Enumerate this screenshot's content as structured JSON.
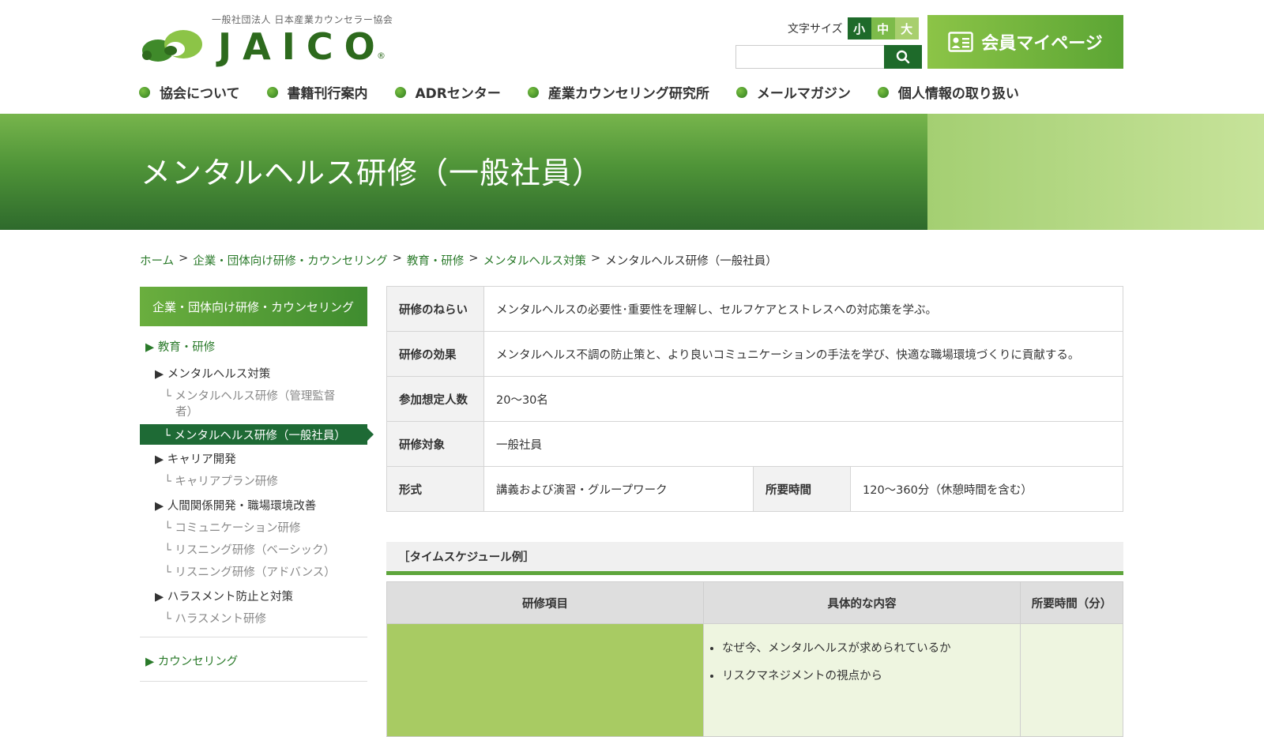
{
  "header": {
    "org_sub": "一般社団法人 日本産業カウンセラー協会",
    "logo_text": "JAICO",
    "logo_reg": "®",
    "fontsize_label": "文字サイズ",
    "fontsize_options": [
      "小",
      "中",
      "大"
    ],
    "search_placeholder": "",
    "mypage_label": "会員マイページ"
  },
  "gnav": [
    "協会について",
    "書籍刊行案内",
    "ADRセンター",
    "産業カウンセリング研究所",
    "メールマガジン",
    "個人情報の取り扱い"
  ],
  "hero": {
    "title": "メンタルヘルス研修（一般社員）"
  },
  "breadcrumb": {
    "items": [
      "ホーム",
      "企業・団体向け研修・カウンセリング",
      "教育・研修",
      "メンタルヘルス対策"
    ],
    "separator": ">",
    "current": "メンタルヘルス研修（一般社員）"
  },
  "sidebar": {
    "heading": "企業・団体向け研修・カウンセリング",
    "education": "▶ 教育・研修",
    "mental": "▶ メンタルヘルス対策",
    "mental_mgmt": "└ メンタルヘルス研修（管理監督",
    "mental_mgmt2": "者）",
    "mental_general": "└ メンタルヘルス研修（一般社員）",
    "career": "▶ キャリア開発",
    "career_plan": "└ キャリアプラン研修",
    "relations": "▶ 人間関係開発・職場環境改善",
    "communication": "└ コミュニケーション研修",
    "listening_basic": "└ リスニング研修（ベーシック）",
    "listening_adv": "└ リスニング研修（アドバンス）",
    "harassment": "▶ ハラスメント防止と対策",
    "harassment_train": "└ ハラスメント研修",
    "counseling": "▶ カウンセリング"
  },
  "info": {
    "aim_label": "研修のねらい",
    "aim": "メンタルヘルスの必要性･重要性を理解し、セルフケアとストレスへの対応策を学ぶ。",
    "effect_label": "研修の効果",
    "effect": "メンタルヘルス不調の防止策と、より良いコミュニケーションの手法を学び、快適な職場環境づくりに貢献する。",
    "people_label": "参加想定人数",
    "people": "20～30名",
    "target_label": "研修対象",
    "target": "一般社員",
    "format_label": "形式",
    "format": "講義および演習・グループワーク",
    "time_label": "所要時間",
    "time": "120～360分（休憩時間を含む）"
  },
  "schedule": {
    "title": "［タイムスケジュール例］",
    "headers": [
      "研修項目",
      "具体的な内容",
      "所要時間（分）"
    ],
    "row1_items": [
      "なぜ今、メンタルヘルスが求められているか",
      "リスクマネジメントの視点から"
    ]
  }
}
